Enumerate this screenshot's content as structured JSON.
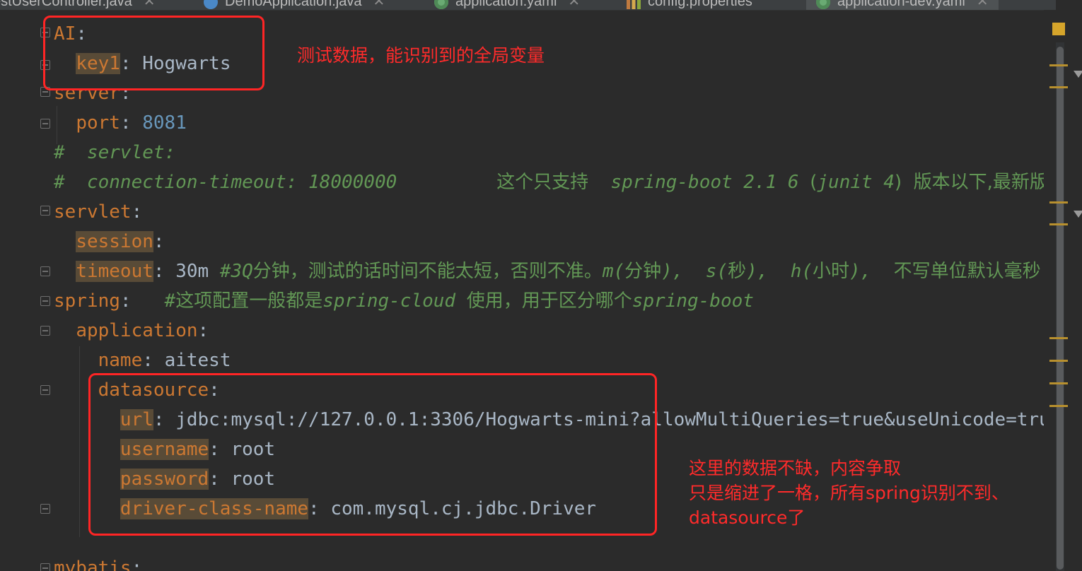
{
  "tabs": [
    {
      "label": "estUserController.java",
      "icon": "none"
    },
    {
      "label": "DemoApplication.java",
      "icon": "java-class-icon"
    },
    {
      "label": "application.yaml",
      "icon": "spring-yaml-icon"
    },
    {
      "label": "config.properties",
      "icon": "properties-file-icon"
    },
    {
      "label": "application-dev.yaml",
      "icon": "spring-yaml-icon",
      "active": true
    }
  ],
  "code": {
    "l1_key": "AI",
    "l2_key": "key1",
    "l2_val": "Hogwarts",
    "l3_key": "server",
    "l4_key": "port",
    "l4_val": "8081",
    "l5_comment": "#  servlet:",
    "l6_comment_a": "#  connection-timeout: 18000000         ",
    "l6_comment_b": "这个只支持",
    "l6_comment_c": "  spring-boot 2.1 6 ",
    "l6_comment_d": "(",
    "l6_comment_e": "junit 4",
    "l6_comment_f": ")  版本以下,最新版",
    "l7_key": "servlet",
    "l8_key": "session",
    "l9_key": "timeout",
    "l9_val": "30m",
    "l9_comment_a": "#3Q",
    "l9_comment_b": "分钟，测试的话时间不能太短，否则不准。",
    "l9_comment_c": "m(",
    "l9_comment_d": "分钟",
    "l9_comment_e": "),  s(",
    "l9_comment_f": "秒",
    "l9_comment_g": "),  h(",
    "l9_comment_h": "小时",
    "l9_comment_i": "),  ",
    "l9_comment_j": "不写单位默认毫秒",
    "l10_key": "spring",
    "l10_comment_a": "#",
    "l10_comment_b": "这项配置一般都是",
    "l10_comment_c": "spring-cloud ",
    "l10_comment_d": "使用，用于区分哪个",
    "l10_comment_e": "spring-boot",
    "l11_key": "application",
    "l12_key": "name",
    "l12_val": "aitest",
    "l13_key": "datasource",
    "l14_key": "url",
    "l14_val": "jdbc:mysql://127.0.0.1:3306/Hogwarts-mini?allowMultiQueries=true&useUnicode=tru",
    "l15_key": "username",
    "l15_val": "root",
    "l16_key": "password",
    "l16_val": "root",
    "l17_key": "driver-class-name",
    "l17_val": "com.mysql.cj.jdbc.Driver",
    "l19_key": "mybatis"
  },
  "annotations": {
    "top": "测试数据，能识别到的全局变量",
    "bottom_1": "这里的数据不缺，内容争取",
    "bottom_2": "只是缩进了一格，所有spring识别不到、",
    "bottom_3": "datasource了"
  },
  "colors": {
    "editor_bg": "#2b2b2b",
    "yaml_key": "#cc7832",
    "value": "#a9b7c6",
    "number": "#6897bb",
    "comment": "#629755",
    "annotation_red": "#ff2525",
    "unresolved_key_bg": "#594b37"
  }
}
